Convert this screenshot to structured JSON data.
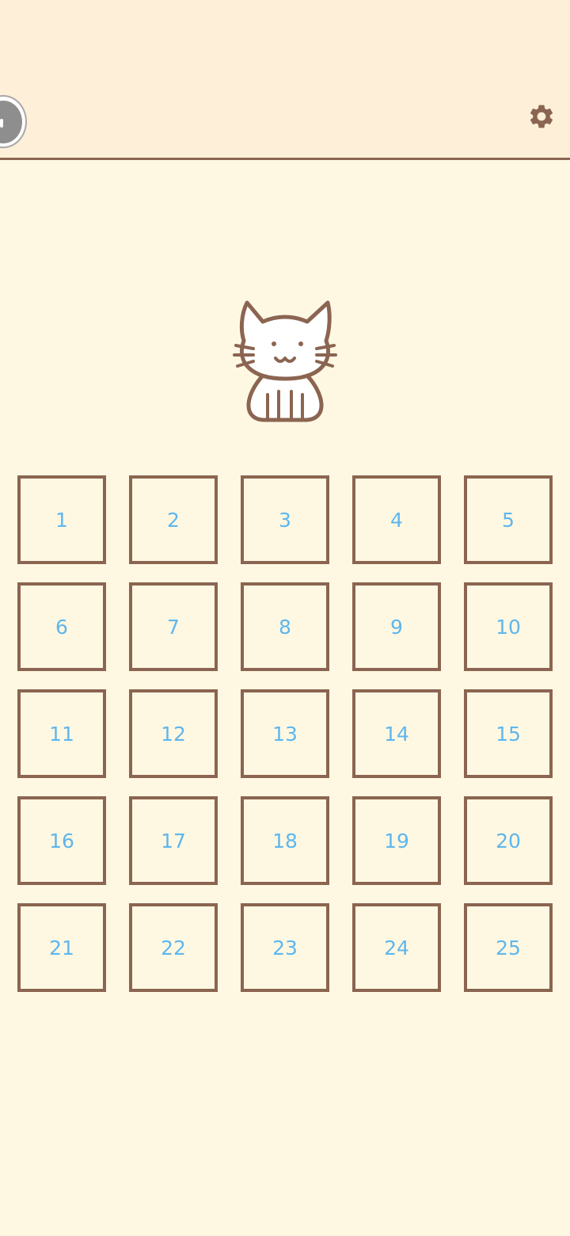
{
  "header": {
    "floating_button_icon": "pause-icon",
    "settings_icon": "gear-icon"
  },
  "mascot": {
    "icon": "cat-icon"
  },
  "level_grid": {
    "levels": [
      "1",
      "2",
      "3",
      "4",
      "5",
      "6",
      "7",
      "8",
      "9",
      "10",
      "11",
      "12",
      "13",
      "14",
      "15",
      "16",
      "17",
      "18",
      "19",
      "20",
      "21",
      "22",
      "23",
      "24",
      "25"
    ]
  },
  "colors": {
    "background": "#fef8e3",
    "header_background": "#fdefd8",
    "border_brown": "#8b6551",
    "number_blue": "#5fb6ec",
    "floating_gray": "#8e8e8e"
  }
}
